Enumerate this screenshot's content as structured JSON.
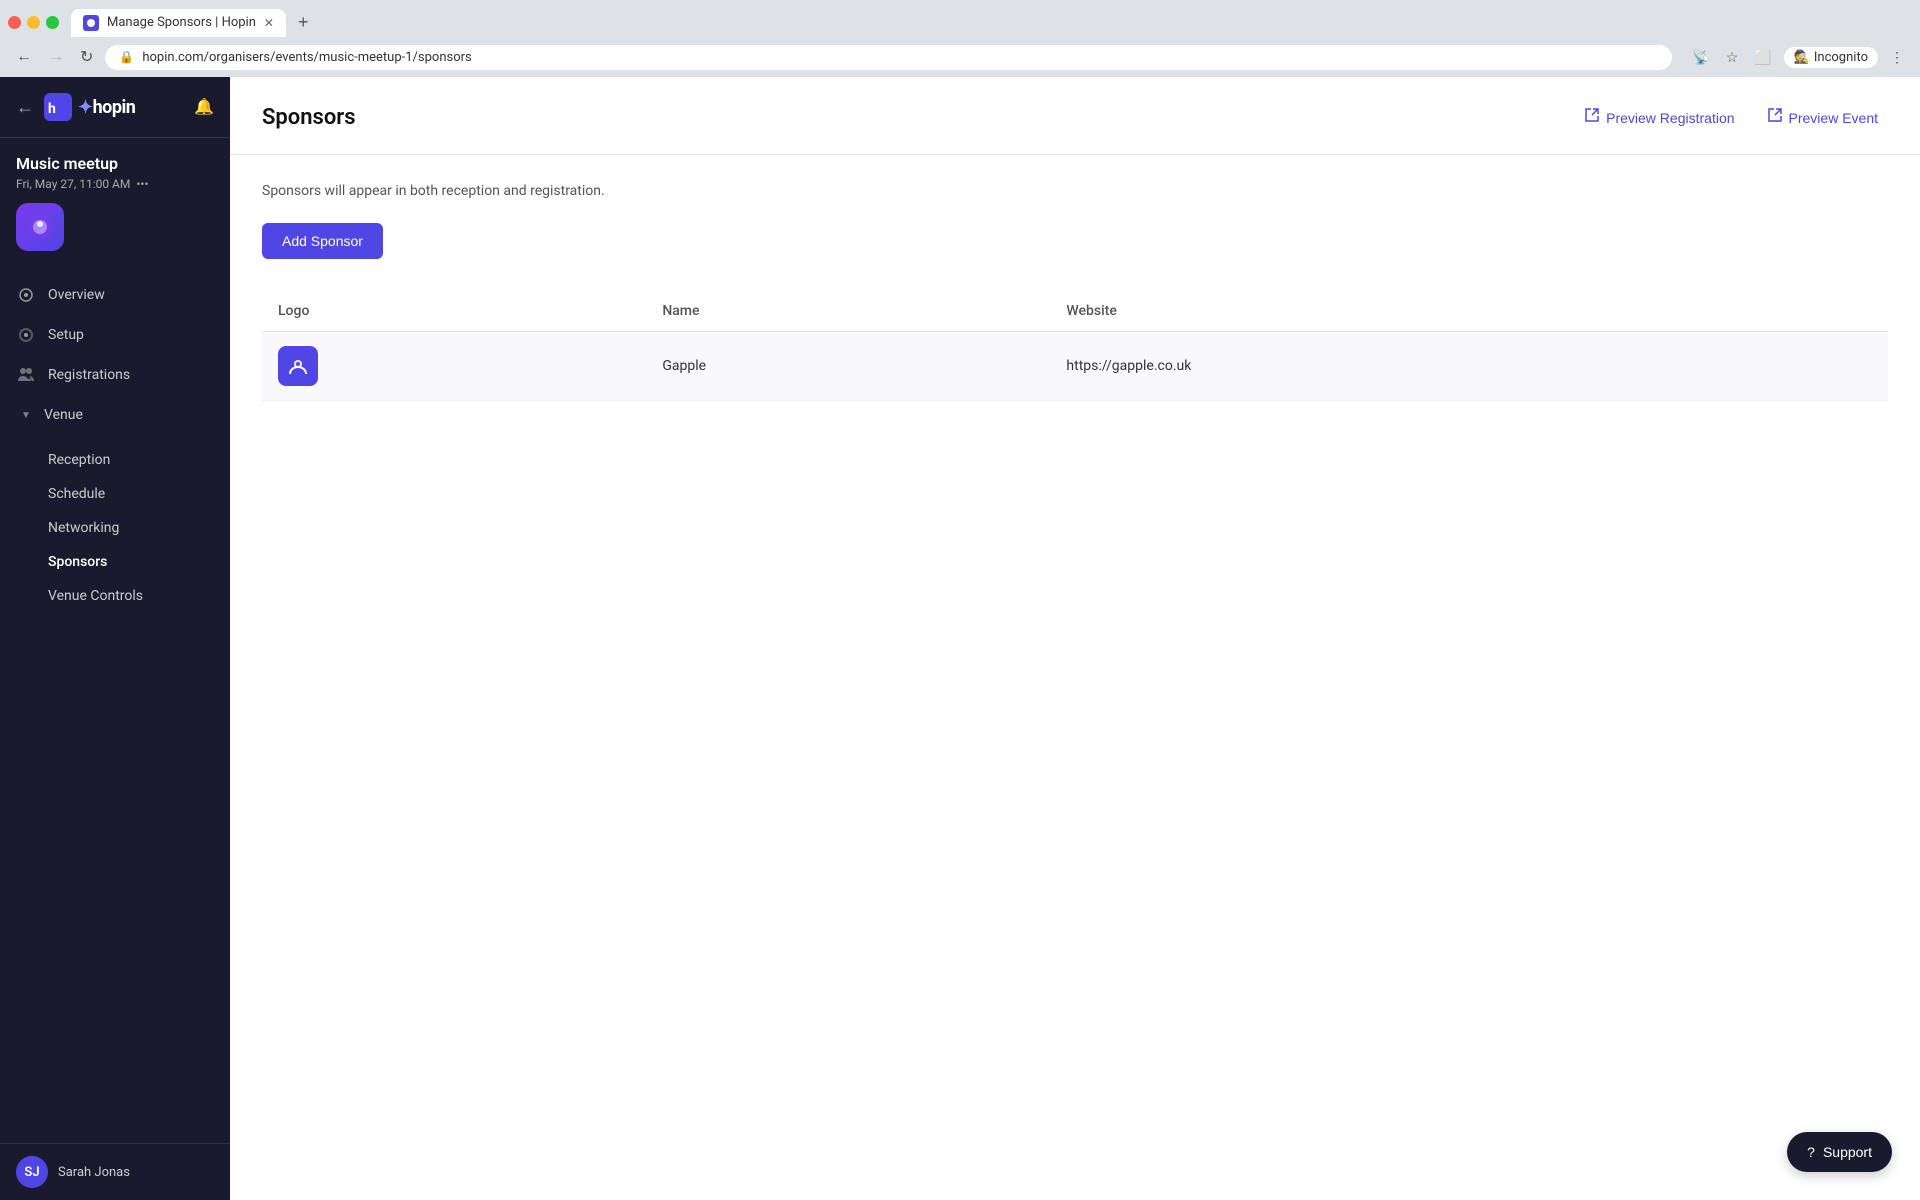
{
  "browser": {
    "tab_title": "Manage Sponsors | Hopin",
    "tab_icon": "hopin-icon",
    "address": "hopin.com/organisers/events/music-meetup-1/sponsors",
    "incognito_label": "Incognito"
  },
  "sidebar": {
    "logo_text": "hopin",
    "event": {
      "name": "Music meetup",
      "date": "Fri, May 27, 11:00 AM"
    },
    "nav_items": [
      {
        "id": "overview",
        "label": "Overview",
        "icon": "circle-dot"
      },
      {
        "id": "setup",
        "label": "Setup",
        "icon": "gear"
      },
      {
        "id": "registrations",
        "label": "Registrations",
        "icon": "users"
      },
      {
        "id": "venue",
        "label": "Venue",
        "icon": "chevron-down",
        "expanded": true
      }
    ],
    "venue_sub_items": [
      {
        "id": "reception",
        "label": "Reception"
      },
      {
        "id": "schedule",
        "label": "Schedule"
      },
      {
        "id": "networking",
        "label": "Networking"
      },
      {
        "id": "sponsors",
        "label": "Sponsors",
        "active": true
      },
      {
        "id": "venue-controls",
        "label": "Venue Controls"
      }
    ],
    "user": {
      "name": "Sarah Jonas",
      "initials": "SJ"
    }
  },
  "page": {
    "title": "Sponsors",
    "description": "Sponsors will appear in both reception and registration.",
    "add_button_label": "Add Sponsor",
    "preview_registration_label": "Preview Registration",
    "preview_event_label": "Preview Event",
    "table": {
      "columns": [
        "Logo",
        "Name",
        "Website"
      ],
      "rows": [
        {
          "logo_alt": "Gapple logo",
          "name": "Gapple",
          "website": "https://gapple.co.uk"
        }
      ]
    }
  },
  "support": {
    "label": "Support"
  }
}
